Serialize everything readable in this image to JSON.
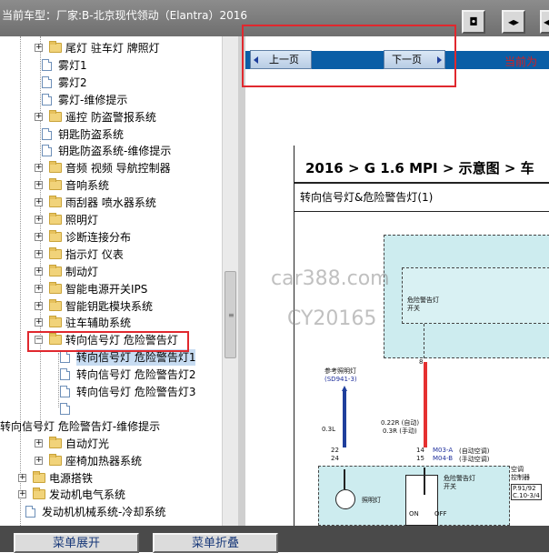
{
  "header": {
    "title": "当前车型：厂家:B-北京现代领动（Elantra）2016"
  },
  "toolbar_buttons": [
    {
      "name": "toolbar-button-1",
      "glyph": "◘"
    },
    {
      "name": "toolbar-button-2",
      "glyph": "◂▸"
    },
    {
      "name": "toolbar-button-3",
      "glyph": "◂"
    }
  ],
  "tree": {
    "items": [
      {
        "label": "尾灯 驻车灯 牌照灯",
        "type": "folder",
        "expand": "+"
      },
      {
        "label": "雾灯1",
        "type": "doc"
      },
      {
        "label": "雾灯2",
        "type": "doc"
      },
      {
        "label": "雾灯-维修提示",
        "type": "doc"
      },
      {
        "label": "遥控 防盗警报系统",
        "type": "folder",
        "expand": "+"
      },
      {
        "label": "钥匙防盗系统",
        "type": "doc"
      },
      {
        "label": "钥匙防盗系统-维修提示",
        "type": "doc"
      },
      {
        "label": "音频 视频 导航控制器",
        "type": "folder",
        "expand": "+"
      },
      {
        "label": "音响系统",
        "type": "folder",
        "expand": "+"
      },
      {
        "label": "雨刮器 喷水器系统",
        "type": "folder",
        "expand": "+"
      },
      {
        "label": "照明灯",
        "type": "folder",
        "expand": "+"
      },
      {
        "label": "诊断连接分布",
        "type": "folder",
        "expand": "+"
      },
      {
        "label": "指示灯 仪表",
        "type": "folder",
        "expand": "+"
      },
      {
        "label": "制动灯",
        "type": "folder",
        "expand": "+"
      },
      {
        "label": "智能电源开关IPS",
        "type": "folder",
        "expand": "+"
      },
      {
        "label": "智能钥匙模块系统",
        "type": "folder",
        "expand": "+"
      },
      {
        "label": "驻车辅助系统",
        "type": "folder",
        "expand": "+"
      },
      {
        "label": "转向信号灯 危险警告灯",
        "type": "folder",
        "expand": "−"
      },
      {
        "label": "转向信号灯 危险警告灯1",
        "type": "doc",
        "selected": true
      },
      {
        "label": "转向信号灯 危险警告灯2",
        "type": "doc"
      },
      {
        "label": "转向信号灯 危险警告灯3",
        "type": "doc"
      },
      {
        "label": "",
        "type": "doc"
      },
      {
        "label": "转向信号灯 危险警告灯-维修提示",
        "type": "none"
      },
      {
        "label": "自动灯光",
        "type": "folder",
        "expand": "+"
      },
      {
        "label": "座椅加热器系统",
        "type": "folder",
        "expand": "+"
      },
      {
        "label": "电源搭铁",
        "type": "folder",
        "expand": "+"
      },
      {
        "label": "发动机电气系统",
        "type": "folder",
        "expand": "+"
      },
      {
        "label": "发动机机械系统-冷却系统",
        "type": "doc"
      }
    ]
  },
  "nav": {
    "prev_label": "上一页",
    "next_label": "下一页",
    "current_label": "当前为"
  },
  "document": {
    "heading": "2016 > G 1.6 MPI > 示意图 > 车",
    "subtitle": "转向信号灯&危险警告灯(1)",
    "labels": {
      "hazard_switch_top": "危险警告灯\n开关",
      "pin8": "8",
      "ref_light": "参考照明灯",
      "ref_code": "(SD941-3)",
      "wire_03l": "0.3L",
      "wire_auto": "0.22R (自动)",
      "wire_manual": "0.3R (手动)",
      "pin22": "22",
      "pin24": "24",
      "pin14": "14",
      "pin15": "15",
      "m03a": "M03-A",
      "m03a_desc": "(自动空调)",
      "m04b": "M04-B",
      "m04b_desc": "(手动空调)",
      "ac_ctrl": "空调\n控制器",
      "ref_pages_1": "P.91/92",
      "ref_pages_2": "C.10-3/4",
      "lighting": "照明灯",
      "hazard_switch": "危险警告灯\n开关",
      "on": "ON",
      "off": "OFF"
    }
  },
  "watermark": {
    "line1": "car388.com",
    "line2": "CY20165"
  },
  "bottom": {
    "expand_label": "菜单展开",
    "collapse_label": "菜单折叠"
  },
  "colors": {
    "accent_red": "#e0282e",
    "nav_blue": "#0a5ea6",
    "diagram_fill": "#cdecef",
    "wire_red": "#e53030",
    "wire_blue": "#1f3f9c"
  }
}
